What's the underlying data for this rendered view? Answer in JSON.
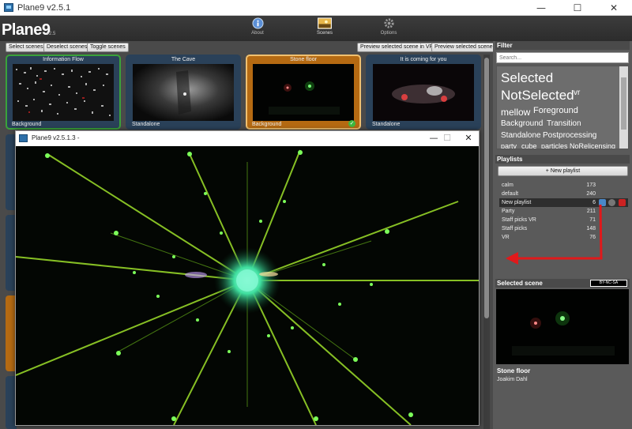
{
  "window": {
    "title": "Plane9 v2.5.1",
    "minimize": "—",
    "maximize": "☐",
    "close": "✕"
  },
  "brand": {
    "name": "Plane9",
    "version": "v2.5"
  },
  "nav": {
    "about": "About",
    "scenes": "Scenes",
    "options": "Options"
  },
  "toolbar": {
    "select": "Select scenes",
    "deselect": "Deselect scenes",
    "toggle": "Toggle scenes",
    "preview_vr": "Preview selected scene in VR",
    "preview": "Preview selected scene"
  },
  "scenes": [
    {
      "name": "Information Flow",
      "type": "Background"
    },
    {
      "name": "The Cave",
      "type": "Standalone"
    },
    {
      "name": "Stone floor",
      "type": "Background",
      "selected": true
    },
    {
      "name": "It is coming for you",
      "type": "Standalone"
    }
  ],
  "filter": {
    "header": "Filter",
    "placeholder": "Search...",
    "tags": [
      "Selected",
      "NotSelected",
      "vr",
      "mellow",
      "Foreground",
      "Background",
      "Transition",
      "Standalone",
      "Postprocessing",
      "party",
      "cube",
      "particles",
      "NoRelicensing"
    ]
  },
  "playlists": {
    "header": "Playlists",
    "new_label": "+ New playlist",
    "items": [
      {
        "name": "calm",
        "count": "173"
      },
      {
        "name": "default",
        "count": "240"
      },
      {
        "name": "New playlist",
        "count": "6"
      },
      {
        "name": "Party",
        "count": "211"
      },
      {
        "name": "Staff picks VR",
        "count": "71"
      },
      {
        "name": "Staff picks",
        "count": "148"
      },
      {
        "name": "VR",
        "count": "76"
      }
    ]
  },
  "selected_scene": {
    "header": "Selected scene",
    "license": "BY-NC-SA",
    "name": "Stone floor",
    "author": "Joakim Dahl"
  },
  "preview_window": {
    "title": "Plane9 v2.5.1.3 -",
    "minimize": "—",
    "maximize": "☐",
    "close": "✕"
  },
  "colors": {
    "accent_orange": "#b56a12",
    "selected_green": "#3aa23a",
    "arrow_red": "#e0191b"
  }
}
